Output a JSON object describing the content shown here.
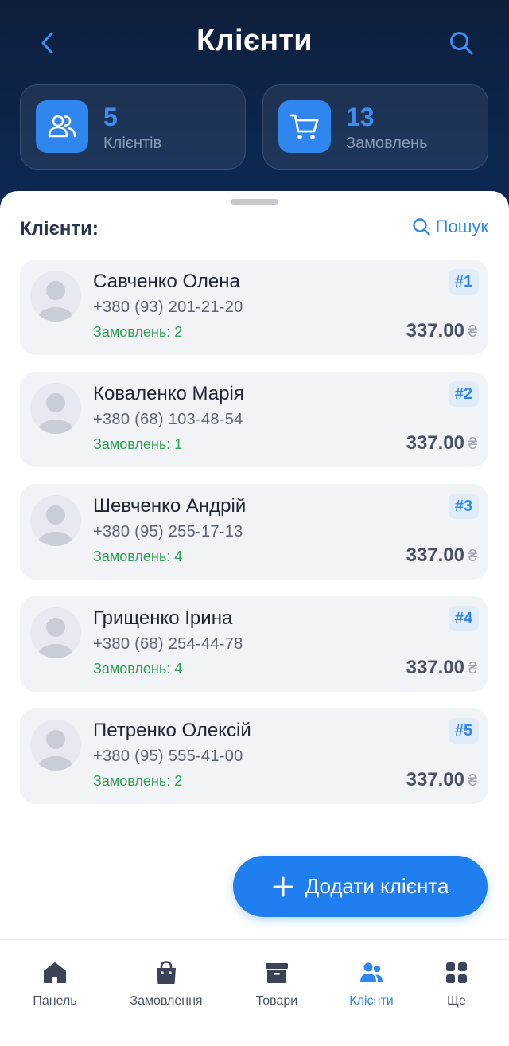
{
  "header": {
    "title": "Клієнти"
  },
  "stats": [
    {
      "value": "5",
      "label": "Клієнтів",
      "icon": "users-icon"
    },
    {
      "value": "13",
      "label": "Замовлень",
      "icon": "cart-icon"
    }
  ],
  "section": {
    "title": "Клієнти:",
    "search_label": "Пошук"
  },
  "clients": [
    {
      "name": "Савченко Олена",
      "phone": "+380 (93) 201-21-20",
      "orders": "Замовлень: 2",
      "badge": "#1",
      "amount": "337.00",
      "currency": "₴"
    },
    {
      "name": "Коваленко Марія",
      "phone": "+380 (68) 103-48-54",
      "orders": "Замовлень: 1",
      "badge": "#2",
      "amount": "337.00",
      "currency": "₴"
    },
    {
      "name": "Шевченко Андрій",
      "phone": "+380 (95) 255-17-13",
      "orders": "Замовлень: 4",
      "badge": "#3",
      "amount": "337.00",
      "currency": "₴"
    },
    {
      "name": "Грищенко Ірина",
      "phone": "+380 (68) 254-44-78",
      "orders": "Замовлень: 4",
      "badge": "#4",
      "amount": "337.00",
      "currency": "₴"
    },
    {
      "name": "Петренко Олексій",
      "phone": "+380 (95) 555-41-00",
      "orders": "Замовлень: 2",
      "badge": "#5",
      "amount": "337.00",
      "currency": "₴"
    }
  ],
  "add_button": {
    "label": "Додати клієнта"
  },
  "tabbar": {
    "items": [
      {
        "label": "Панель",
        "icon": "home-icon"
      },
      {
        "label": "Замовлення",
        "icon": "shopping-bag-icon"
      },
      {
        "label": "Товари",
        "icon": "archive-box-icon"
      },
      {
        "label": "Клієнти",
        "icon": "users-icon",
        "active": true
      },
      {
        "label": "Ще",
        "icon": "grid-icon"
      }
    ]
  },
  "colors": {
    "accent": "#2f86ef",
    "header_bg": "#0e1f3c",
    "orders_green": "#2aa351"
  }
}
